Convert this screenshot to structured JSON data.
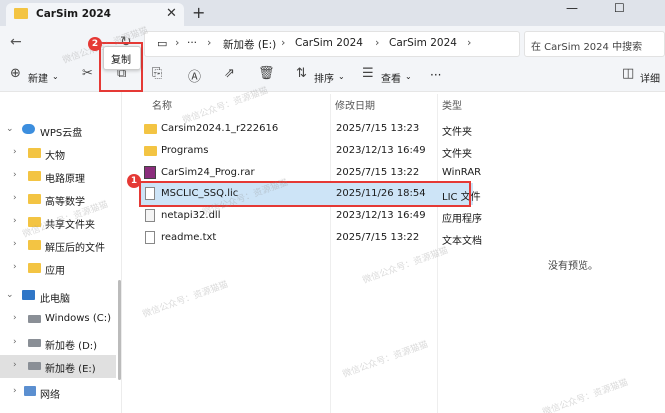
{
  "window": {
    "tab_title": "CarSim 2024",
    "minimize": "—",
    "maximize": "☐"
  },
  "address": {
    "crumbs": [
      "新加卷 (E:)",
      "CarSim 2024",
      "CarSim 2024"
    ],
    "ellipsis": "···",
    "search_placeholder": "在 CarSim 2024 中搜索"
  },
  "toolbar": {
    "new_label": "新建",
    "sort_label": "排序",
    "view_label": "查看",
    "more_label": "···",
    "details_label": "详细",
    "tooltip": "复制"
  },
  "badges": {
    "step1": "1",
    "step2": "2"
  },
  "sidebar": {
    "items": [
      {
        "label": "WPS云盘"
      },
      {
        "label": "大物"
      },
      {
        "label": "电路原理"
      },
      {
        "label": "高等数学"
      },
      {
        "label": "共享文件夹"
      },
      {
        "label": "解压后的文件"
      },
      {
        "label": "应用"
      },
      {
        "label": "此电脑"
      },
      {
        "label": "Windows (C:)"
      },
      {
        "label": "新加卷 (D:)"
      },
      {
        "label": "新加卷 (E:)"
      },
      {
        "label": "网络"
      }
    ]
  },
  "columns": {
    "name": "名称",
    "date": "修改日期",
    "type": "类型"
  },
  "files": [
    {
      "name": "Carsim2024.1_r222616",
      "date": "2025/7/15 13:23",
      "type": "文件夹"
    },
    {
      "name": "Programs",
      "date": "2023/12/13 16:49",
      "type": "文件夹"
    },
    {
      "name": "CarSim24_Prog.rar",
      "date": "2025/7/15 13:22",
      "type": "WinRAR"
    },
    {
      "name": "MSCLIC_SSQ.lic",
      "date": "2025/11/26 18:54",
      "type": "LIC 文件"
    },
    {
      "name": "netapi32.dll",
      "date": "2023/12/13 16:49",
      "type": "应用程序"
    },
    {
      "name": "readme.txt",
      "date": "2025/7/15 13:22",
      "type": "文本文档"
    }
  ],
  "preview_text": "没有预览。",
  "watermark": "微信公众号：资源猫猫"
}
